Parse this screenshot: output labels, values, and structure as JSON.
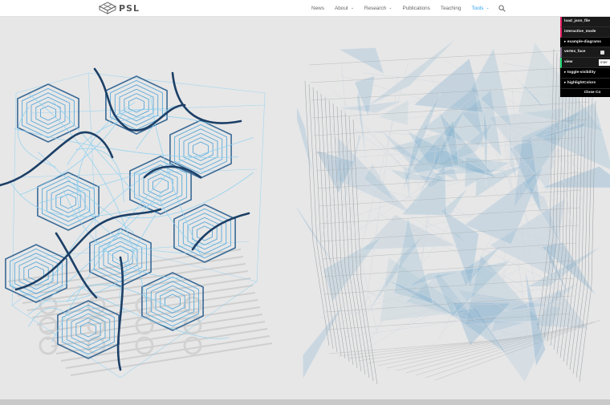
{
  "header": {
    "logo_text": "PSL",
    "nav": [
      {
        "label": "News",
        "dropdown": false,
        "active": false
      },
      {
        "label": "About",
        "dropdown": true,
        "active": false
      },
      {
        "label": "Research",
        "dropdown": true,
        "active": false
      },
      {
        "label": "Publications",
        "dropdown": false,
        "active": false
      },
      {
        "label": "Teaching",
        "dropdown": false,
        "active": false
      },
      {
        "label": "Tools",
        "dropdown": true,
        "active": true
      }
    ],
    "search_icon": "search-icon",
    "accent_color": "#2ea3f2"
  },
  "gui": {
    "rows": [
      {
        "type": "button",
        "label": "load_json_file"
      },
      {
        "type": "button",
        "label": "interactive_mode"
      },
      {
        "type": "folder",
        "label": "example-diagrams"
      },
      {
        "type": "bool",
        "label": "vertex_face",
        "checked": false
      },
      {
        "type": "string",
        "label": "view",
        "value": "inter"
      },
      {
        "type": "folder",
        "label": "toggle-visibility"
      },
      {
        "type": "folder",
        "label": "highlightColors"
      }
    ],
    "close_label": "Close Co"
  },
  "colors": {
    "background": "#e7e7e7",
    "light_wire": "#8fd0f0",
    "dark_wire": "#1c3f66",
    "faces": "#6aa3c9",
    "grid": "#a4a8ac"
  }
}
